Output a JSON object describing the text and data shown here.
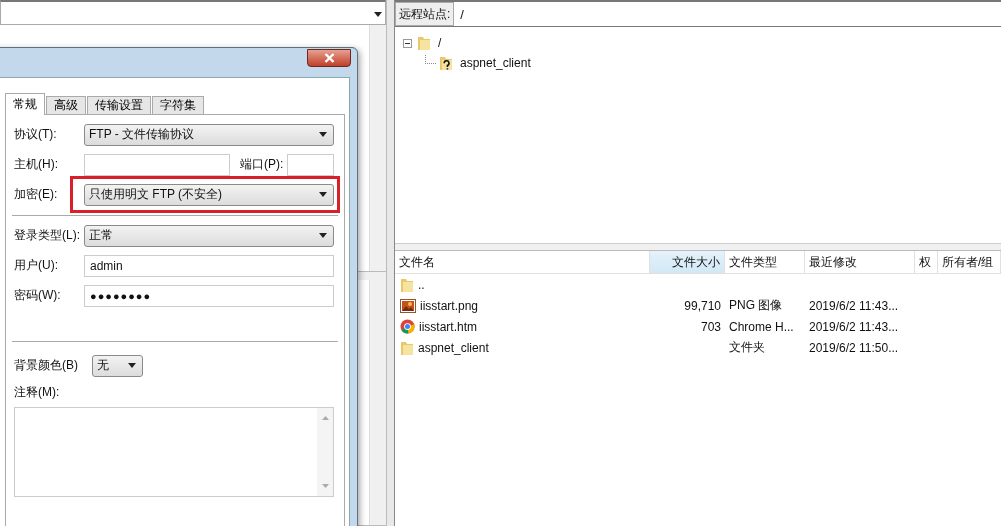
{
  "dialog": {
    "tabs": [
      {
        "label": "常规",
        "selected": true
      },
      {
        "label": "高级",
        "selected": false
      },
      {
        "label": "传输设置",
        "selected": false
      },
      {
        "label": "字符集",
        "selected": false
      }
    ],
    "protocol": {
      "label": "协议(T):",
      "value": "FTP - 文件传输协议"
    },
    "host": {
      "label": "主机(H):"
    },
    "port": {
      "label": "端口(P):"
    },
    "encryption": {
      "label": "加密(E):",
      "value": "只使用明文 FTP (不安全)",
      "highlighted": true
    },
    "logon_type": {
      "label": "登录类型(L):",
      "value": "正常"
    },
    "user": {
      "label": "用户(U):",
      "value": "admin"
    },
    "password": {
      "label": "密码(W):",
      "value": "●●●●●●●●"
    },
    "background_color": {
      "label": "背景颜色(B)",
      "value": "无"
    },
    "comments": {
      "label": "注释(M):"
    }
  },
  "remote": {
    "label": "远程站点:",
    "path": "/",
    "tree": [
      {
        "name": "/",
        "expanded": true,
        "children": [
          {
            "name": "aspnet_client",
            "kind": "unknown"
          }
        ]
      }
    ]
  },
  "files": {
    "columns": [
      {
        "label": "文件名",
        "sorted": false
      },
      {
        "label": "文件大小",
        "sorted": true
      },
      {
        "label": "文件类型",
        "sorted": false
      },
      {
        "label": "最近修改",
        "sorted": false
      },
      {
        "label": "权",
        "sorted": false
      },
      {
        "label": "所有者/组",
        "sorted": false
      }
    ],
    "rows": [
      {
        "kind": "folder",
        "name": "..",
        "size": "",
        "type": "",
        "modified": ""
      },
      {
        "kind": "image",
        "name": "iisstart.png",
        "size": "99,710",
        "type": "PNG 图像",
        "modified": "2019/6/2 11:43..."
      },
      {
        "kind": "web",
        "name": "iisstart.htm",
        "size": "703",
        "type": "Chrome H...",
        "modified": "2019/6/2 11:43..."
      },
      {
        "kind": "folder",
        "name": "aspnet_client",
        "size": "",
        "type": "文件夹",
        "modified": "2019/6/2 11:50..."
      }
    ]
  }
}
